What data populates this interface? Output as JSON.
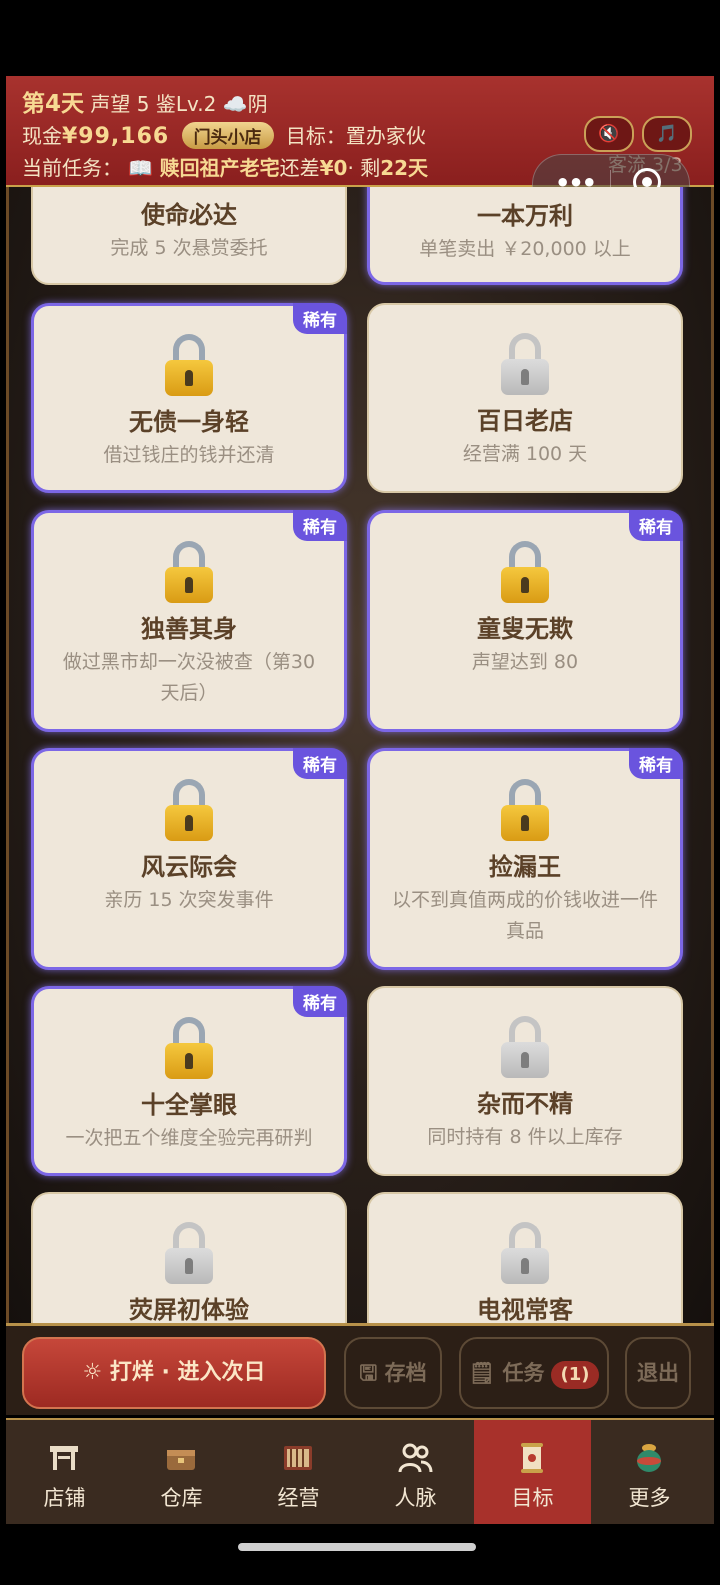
{
  "header": {
    "day": "第4天",
    "reputation": "声望 5",
    "appraisal": "鉴Lv.2",
    "weather_icon": "☁️",
    "weather": "阴",
    "cash_label": "现金",
    "cash": "¥99,166",
    "shop_badge": "门头小店",
    "goal": "目标：置办家伙",
    "task_label": "当前任务：",
    "task_icon": "📖",
    "task_name": "赎回祖产老宅",
    "task_gap_label": "还差",
    "task_gap": "¥0",
    "task_sep": "·",
    "days_left_label": "剩",
    "days_left": "22天",
    "guests": "客流 3/3",
    "mute_icon": "🔇",
    "music_icon": "🎵"
  },
  "achievements": [
    {
      "title": "使命必达",
      "desc": "完成 5 次悬赏委托",
      "rare": false,
      "locked": false
    },
    {
      "title": "一本万利",
      "desc": "单笔卖出 ￥20,000 以上",
      "rare": true,
      "locked": false
    },
    {
      "title": "无债一身轻",
      "desc": "借过钱庄的钱并还清",
      "rare": true,
      "tag": "稀有"
    },
    {
      "title": "百日老店",
      "desc": "经营满 100 天",
      "rare": false
    },
    {
      "title": "独善其身",
      "desc": "做过黑市却一次没被查（第30天后）",
      "rare": true,
      "tag": "稀有"
    },
    {
      "title": "童叟无欺",
      "desc": "声望达到 80",
      "rare": true,
      "tag": "稀有"
    },
    {
      "title": "风云际会",
      "desc": "亲历 15 次突发事件",
      "rare": true,
      "tag": "稀有"
    },
    {
      "title": "捡漏王",
      "desc": "以不到真值两成的价钱收进一件真品",
      "rare": true,
      "tag": "稀有"
    },
    {
      "title": "十全掌眼",
      "desc": "一次把五个维度全验完再研判",
      "rare": true,
      "tag": "稀有"
    },
    {
      "title": "杂而不精",
      "desc": "同时持有 8 件以上库存",
      "rare": false
    },
    {
      "title": "荧屏初体验",
      "desc": "",
      "rare": false
    },
    {
      "title": "电视常客",
      "desc": "",
      "rare": false
    }
  ],
  "actions": {
    "next_day": "☼  打烊 · 进入次日",
    "save": "🖫 存档",
    "tasks": "🗒 任务",
    "tasks_count": "(1)",
    "exit": "退出"
  },
  "nav": [
    {
      "label": "店铺",
      "icon": "shop-icon"
    },
    {
      "label": "仓库",
      "icon": "warehouse-icon"
    },
    {
      "label": "经营",
      "icon": "abacus-icon"
    },
    {
      "label": "人脉",
      "icon": "people-icon"
    },
    {
      "label": "目标",
      "icon": "scroll-icon",
      "active": true
    },
    {
      "label": "更多",
      "icon": "vase-icon"
    }
  ],
  "colors": {
    "rare_border": "#7c67e6",
    "header_bg": "#a8322e",
    "active_tab": "#a8312b"
  }
}
